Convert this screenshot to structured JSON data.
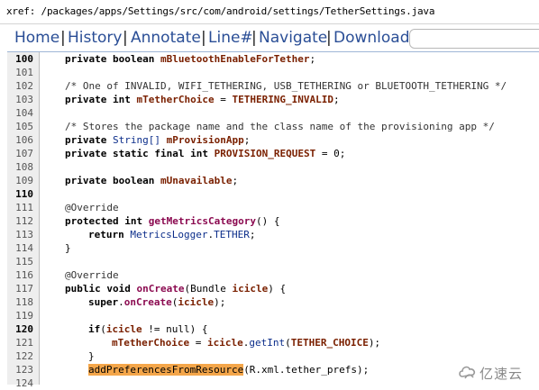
{
  "xref": {
    "path": "xref: /packages/apps/Settings/src/com/android/settings/TetherSettings.java"
  },
  "nav": {
    "items": [
      {
        "label": "Home"
      },
      {
        "label": "History"
      },
      {
        "label": "Annotate"
      },
      {
        "label": "Line#"
      },
      {
        "label": "Navigate"
      },
      {
        "label": "Download"
      }
    ],
    "separator": "|",
    "search_value": ""
  },
  "code": {
    "lines": [
      {
        "n": "100",
        "marked": true
      },
      {
        "n": "101",
        "marked": false
      },
      {
        "n": "102",
        "marked": false
      },
      {
        "n": "103",
        "marked": false
      },
      {
        "n": "104",
        "marked": false
      },
      {
        "n": "105",
        "marked": false
      },
      {
        "n": "106",
        "marked": false
      },
      {
        "n": "107",
        "marked": false
      },
      {
        "n": "108",
        "marked": false
      },
      {
        "n": "109",
        "marked": false
      },
      {
        "n": "110",
        "marked": true
      },
      {
        "n": "111",
        "marked": false
      },
      {
        "n": "112",
        "marked": false
      },
      {
        "n": "113",
        "marked": false
      },
      {
        "n": "114",
        "marked": false
      },
      {
        "n": "115",
        "marked": false
      },
      {
        "n": "116",
        "marked": false
      },
      {
        "n": "117",
        "marked": false
      },
      {
        "n": "118",
        "marked": false
      },
      {
        "n": "119",
        "marked": false
      },
      {
        "n": "120",
        "marked": true
      },
      {
        "n": "121",
        "marked": false
      },
      {
        "n": "122",
        "marked": false
      },
      {
        "n": "123",
        "marked": false
      },
      {
        "n": "124",
        "marked": false
      }
    ],
    "t": {
      "private": "private",
      "boolean": "boolean",
      "int": "int",
      "static": "static",
      "final": "final",
      "protected": "protected",
      "public": "public",
      "void": "void",
      "return": "return",
      "super": "super",
      "if": "if",
      "null": "null",
      "string_arr": "String[]",
      "override": "@Override",
      "mBluetoothEnableForTether": "mBluetoothEnableForTether",
      "semicolon": ";",
      "cmt102": "/* One of INVALID, WIFI_TETHERING, USB_TETHERING or BLUETOOTH_TETHERING */",
      "mTetherChoice": "mTetherChoice",
      "eq": " = ",
      "TETHERING_INVALID": "TETHERING_INVALID",
      "cmt105": "/* Stores the package name and the class name of the provisioning app */",
      "mProvisionApp": "mProvisionApp",
      "PROVISION_REQUEST": "PROVISION_REQUEST",
      "zero": "0",
      "mUnavailable": "mUnavailable",
      "getMetricsCategory": "getMetricsCategory",
      "parens_brace": "() {",
      "MetricsLogger": "MetricsLogger",
      "dot": ".",
      "TETHER": "TETHER",
      "close_brace": "}",
      "onCreate": "onCreate",
      "bundle_open": "(Bundle ",
      "icicle": "icicle",
      "close_paren_brace": ") {",
      "open_paren": "(",
      "close_paren_semi": ");",
      "neq": " != ",
      "getInt": "getInt",
      "TETHER_CHOICE": "TETHER_CHOICE",
      "addPreferencesFromResource": "addPreferencesFromResource",
      "r_xml": "(R.xml.tether_prefs);"
    }
  },
  "logo": {
    "text": "亿速云",
    "icon": "cloud-logo-icon"
  }
}
